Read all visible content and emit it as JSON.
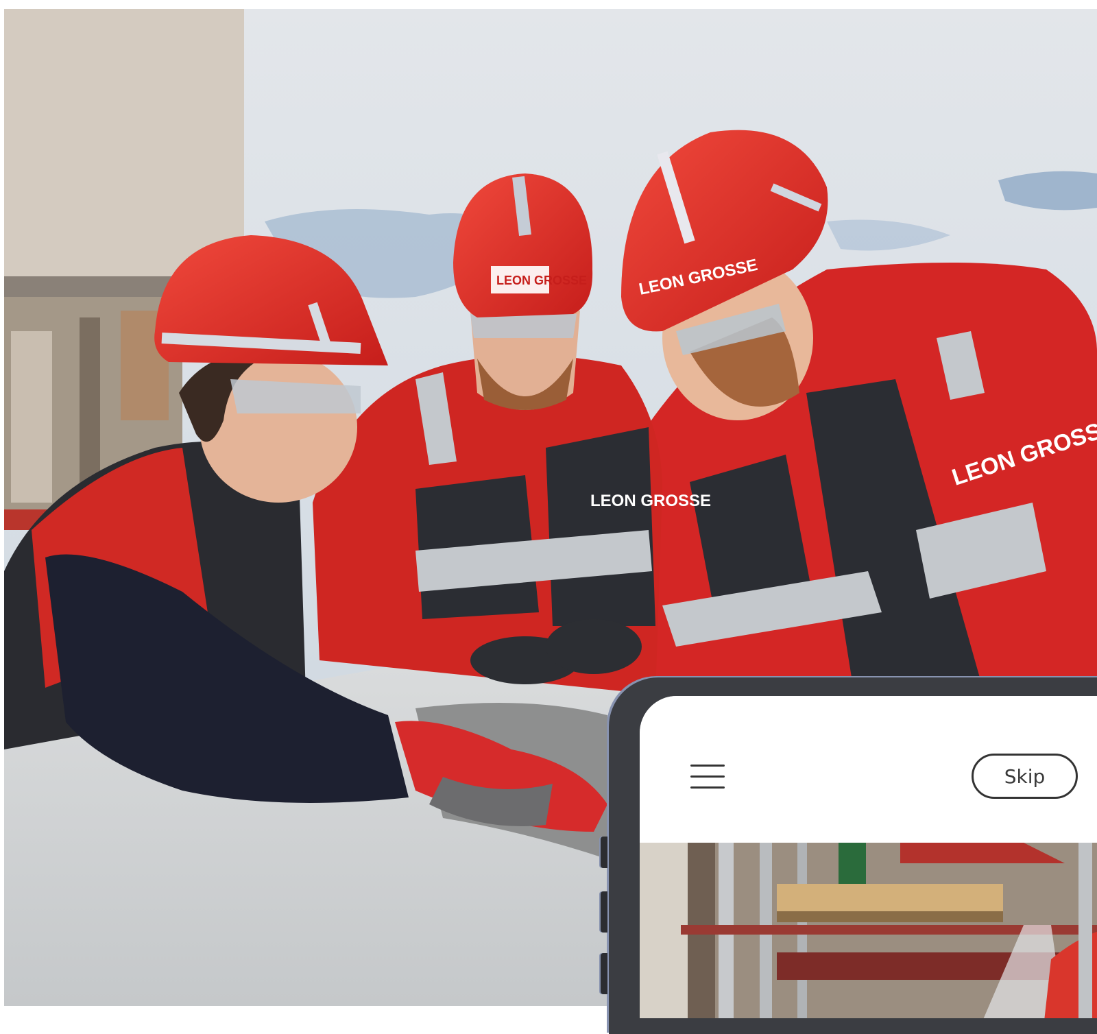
{
  "photo": {
    "logo_text": "LEON GROSSE"
  },
  "phone": {
    "skip_label": "Skip",
    "menu_icon": "hamburger-menu-icon"
  }
}
